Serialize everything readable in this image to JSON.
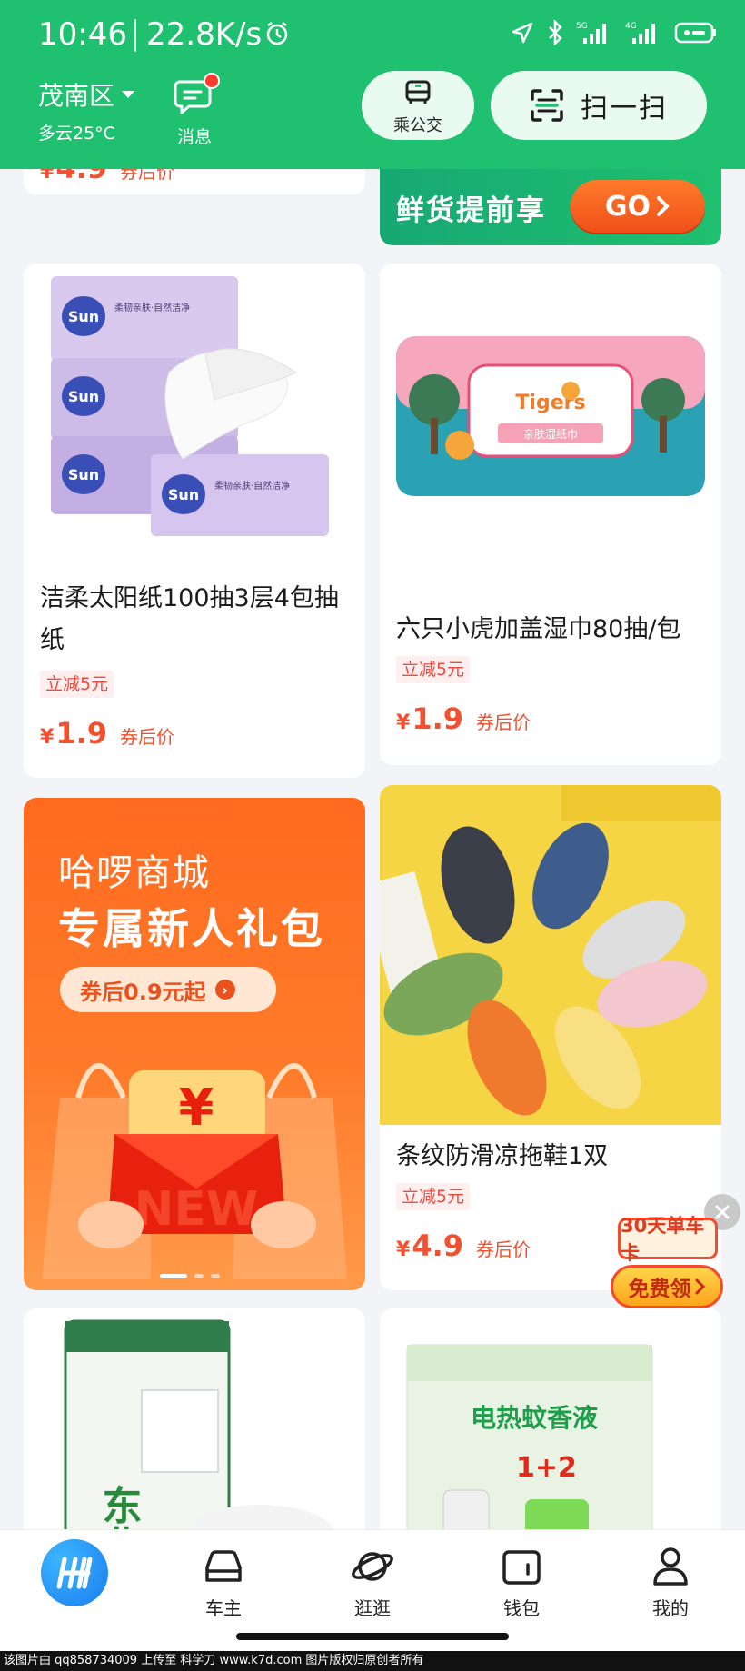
{
  "status": {
    "time": "10:46",
    "speed": "22.8K/s",
    "separator": "|"
  },
  "header": {
    "location": "茂南区",
    "weather": "多云25°C",
    "messages_label": "消息",
    "bus_label": "乘公交",
    "scan_label": "扫一扫"
  },
  "feed": {
    "top_left": {
      "price_yen": "¥",
      "price": "4.9",
      "price_note": "券后价"
    },
    "fresh_banner": {
      "text": "鲜货提前享",
      "go": "GO"
    },
    "products": [
      {
        "title": "洁柔太阳纸100抽3层4包抽纸",
        "tag": "立减5元",
        "price_yen": "¥",
        "price": "1.9",
        "price_note": "券后价"
      },
      {
        "title": "六只小虎加盖湿巾80抽/包",
        "tag": "立减5元",
        "price_yen": "¥",
        "price": "1.9",
        "price_note": "券后价"
      },
      {
        "title": "条纹防滑凉拖鞋1双",
        "tag": "立减5元",
        "price_yen": "¥",
        "price": "4.9",
        "price_note": "券后价"
      }
    ],
    "promo": {
      "line1": "哈啰商城",
      "line2": "专属新人礼包",
      "button": "券后0.9元起"
    },
    "float_badge": {
      "top": "30天单车卡",
      "bottom": "免费领"
    }
  },
  "product_images": {
    "tissue_brand": "Sun",
    "tissue_brand_cn": "太阳",
    "tissue_text": "柔韧亲肤·自然洁净",
    "wipes_brand": "Tigers",
    "wipes_sub": "亲肤湿纸巾",
    "rice_text": "东北大米",
    "mosquito_text": "电热蚊香液",
    "mosquito_combo": "1+2"
  },
  "nav": {
    "items": [
      {
        "label": ""
      },
      {
        "label": "车主"
      },
      {
        "label": "逛逛"
      },
      {
        "label": "钱包"
      },
      {
        "label": "我的"
      }
    ]
  },
  "watermark": "该图片由 qq858734009 上传至 科学刀 www.k7d.com 图片版权归原创者所有",
  "colors": {
    "brand_green": "#1fc06f",
    "price_red": "#f2502f",
    "promo_orange": "#ff6a1f"
  }
}
